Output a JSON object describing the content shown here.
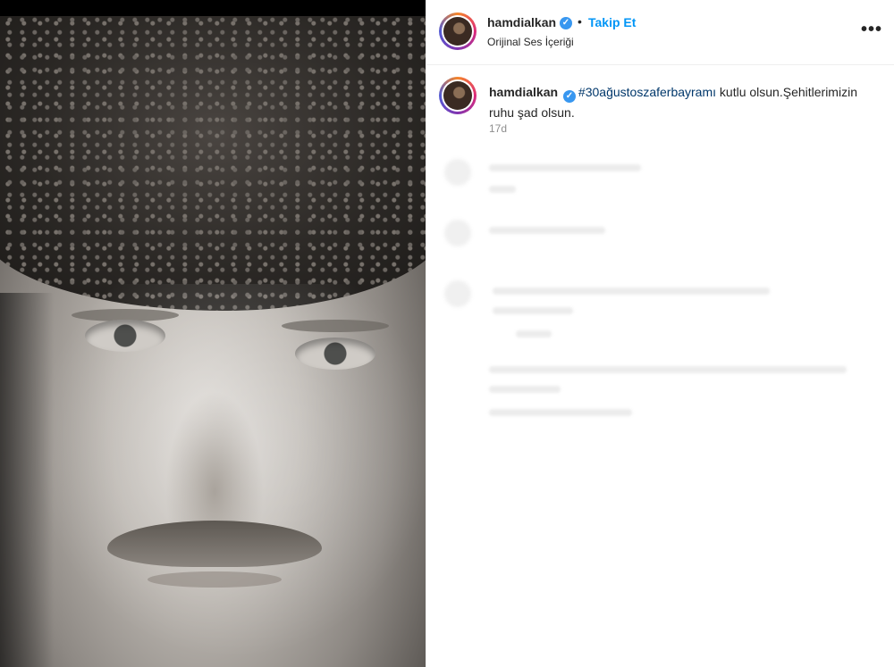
{
  "post": {
    "username": "hamdialkan",
    "follow_label": "Takip Et",
    "separator": "•",
    "audio_label": "Orijinal Ses İçeriği",
    "more_label": "•••",
    "verified_mark": "✓"
  },
  "caption": {
    "username": "hamdialkan",
    "hashtag": "#30ağustoszaferbayramı",
    "text": " kutlu olsun.Şehitlerimizin ruhu şad olsun.",
    "time": "17d"
  },
  "icons": {
    "verified": "verified-badge-icon",
    "more": "more-options-icon"
  },
  "colors": {
    "link_blue": "#0095f6",
    "verified_blue": "#3897f0",
    "hashtag": "#00376b"
  }
}
